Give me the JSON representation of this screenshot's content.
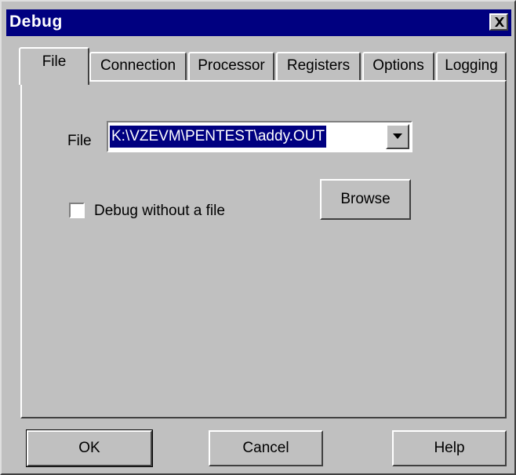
{
  "window": {
    "title": "Debug"
  },
  "tabs": [
    {
      "label": "File",
      "active": true
    },
    {
      "label": "Connection",
      "active": false
    },
    {
      "label": "Processor",
      "active": false
    },
    {
      "label": "Registers",
      "active": false
    },
    {
      "label": "Options",
      "active": false
    },
    {
      "label": "Logging",
      "active": false
    }
  ],
  "file_tab": {
    "file_label": "File",
    "file_value": "K:\\VZEVM\\PENTEST\\addy.OUT",
    "debug_without_file_label": "Debug without a file",
    "debug_without_file_checked": false,
    "browse_label": "Browse"
  },
  "buttons": {
    "ok_label": "OK",
    "cancel_label": "Cancel",
    "help_label": "Help"
  },
  "colors": {
    "titlebar": "#000080",
    "face": "#c0c0c0",
    "selection": "#000080"
  },
  "icons": {
    "close": "close-icon",
    "dropdown": "chevron-down-icon"
  }
}
